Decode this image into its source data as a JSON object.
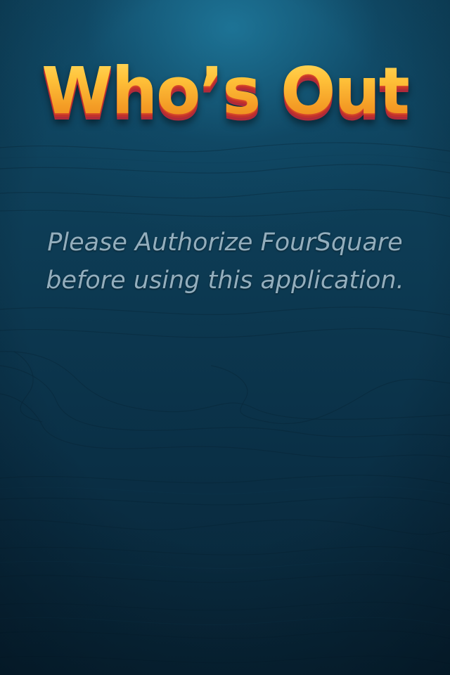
{
  "app": {
    "title": "Who’s Out"
  },
  "message": {
    "line1": "Please Authorize FourSquare",
    "line2": "before using this application."
  },
  "colors": {
    "background_dark": "#082536",
    "background_glow": "#2896be",
    "title_yellow": "#ffc23a",
    "title_orange": "#f39a24",
    "title_shadow_red": "#c2322a",
    "message_text": "#93aebd"
  }
}
